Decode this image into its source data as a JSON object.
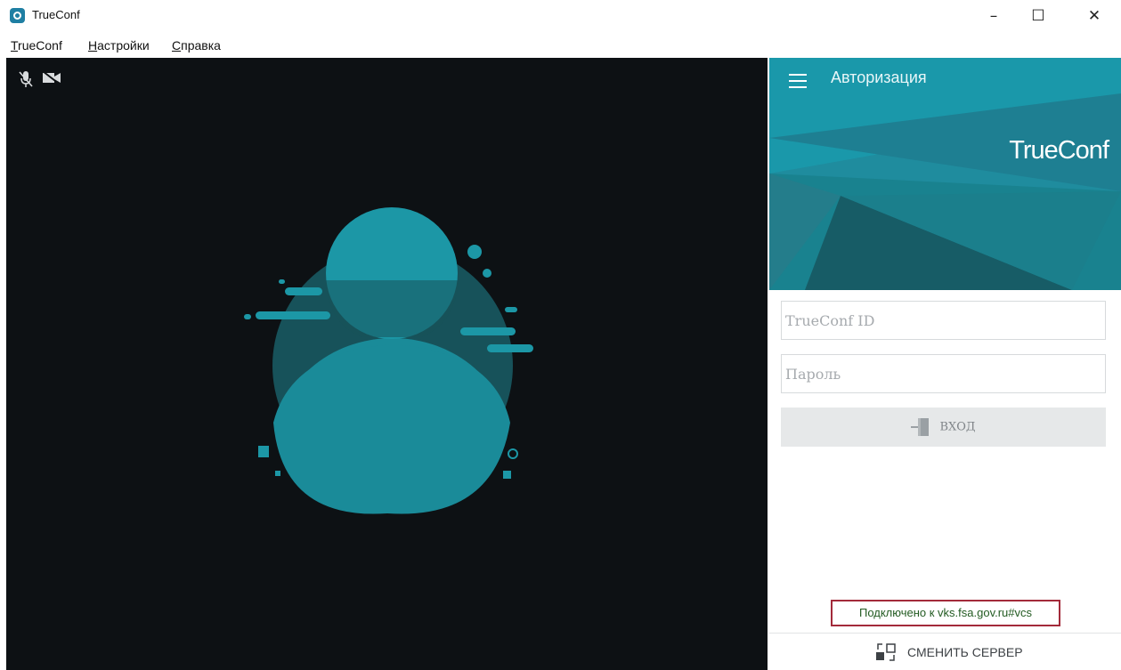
{
  "window": {
    "title": "TrueConf",
    "minimize_glyph": "–",
    "maximize_glyph": "☐",
    "close_glyph": "✕"
  },
  "menu": {
    "items": [
      {
        "first": "T",
        "rest": "rueConf"
      },
      {
        "first": "Н",
        "rest": "астройки"
      },
      {
        "first": "С",
        "rest": "правка"
      }
    ]
  },
  "video": {
    "icons": [
      "microphone-muted-icon",
      "camera-off-icon"
    ],
    "placeholder": "user-avatar-placeholder"
  },
  "panel": {
    "header_title": "Авторизация",
    "brand": "TrueConf",
    "id_placeholder": "TrueConf ID",
    "password_placeholder": "Пароль",
    "login_label": "ВХОД",
    "status_text": "Подключено к vks.fsa.gov.ru#vcs",
    "change_server_label": "СМЕНИТЬ СЕРВЕР"
  },
  "colors": {
    "accent": "#1d8fa0",
    "video_bg": "#0d1114",
    "status_border": "#a32a3a",
    "status_text": "#235b22"
  }
}
